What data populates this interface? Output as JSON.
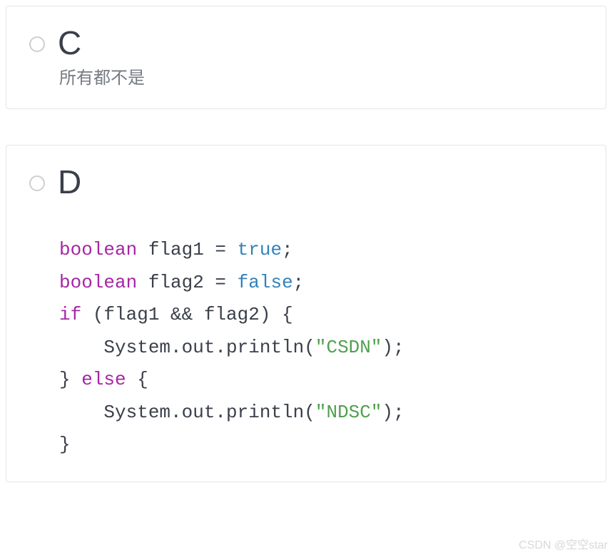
{
  "options": {
    "c": {
      "letter": "C",
      "subtext": "所有都不是"
    },
    "d": {
      "letter": "D",
      "code": {
        "kw_boolean_1": "boolean",
        "var1": " flag1 = ",
        "bool_true": "true",
        "semi1": ";",
        "kw_boolean_2": "boolean",
        "var2": " flag2 = ",
        "bool_false": "false",
        "semi2": ";",
        "kw_if": "if",
        "cond": " (flag1 && flag2) {",
        "line4": "    System.out.println(",
        "str_csdn": "\"CSDN\"",
        "line4_end": ");",
        "kw_else_pre": "} ",
        "kw_else": "else",
        "kw_else_post": " {",
        "line6": "    System.out.println(",
        "str_ndsc": "\"NDSC\"",
        "line6_end": ");",
        "line7": "}"
      }
    }
  },
  "watermark": "CSDN @空空star"
}
